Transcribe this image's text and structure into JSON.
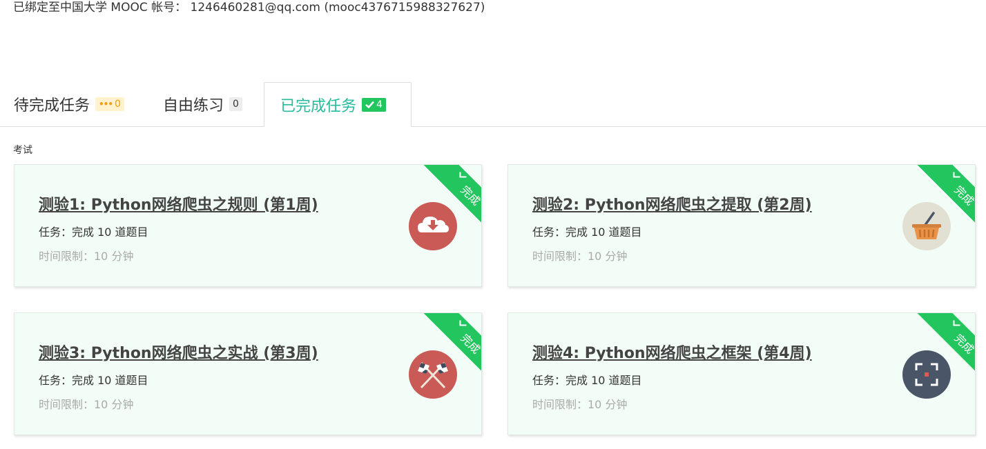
{
  "account": {
    "bind_text": "已绑定至中国大学 MOOC 帐号： 1246460281@qq.com (mooc4376715988327627)"
  },
  "tabs": [
    {
      "label": "待完成任务",
      "badge": "0"
    },
    {
      "label": "自由练习",
      "badge": "0"
    },
    {
      "label": "已完成任务",
      "badge": "4",
      "active": true
    }
  ],
  "section": {
    "label": "考试"
  },
  "ribbon_label": "完成",
  "cards": [
    {
      "title": "测验1: Python网络爬虫之规则 (第1周)",
      "task": "任务：完成 10 道题目",
      "time": "时间限制：10 分钟",
      "icon": "cloud-download-icon",
      "icon_color": "#c95a56"
    },
    {
      "title": "测验2: Python网络爬虫之提取 (第2周)",
      "task": "任务：完成 10 道题目",
      "time": "时间限制：10 分钟",
      "icon": "basket-icon",
      "icon_color": "#e2dfd3"
    },
    {
      "title": "测验3: Python网络爬虫之实战 (第3周)",
      "task": "任务：完成 10 道题目",
      "time": "时间限制：10 分钟",
      "icon": "crossed-flags-icon",
      "icon_color": "#c95a56"
    },
    {
      "title": "测验4: Python网络爬虫之框架 (第4周)",
      "task": "任务：完成 10 道题目",
      "time": "时间限制：10 分钟",
      "icon": "focus-frame-icon",
      "icon_color": "#4a5568"
    }
  ],
  "colors": {
    "accent": "#25bb9b",
    "ribbon": "#22c55e",
    "card_bg": "#f3fdf7"
  }
}
